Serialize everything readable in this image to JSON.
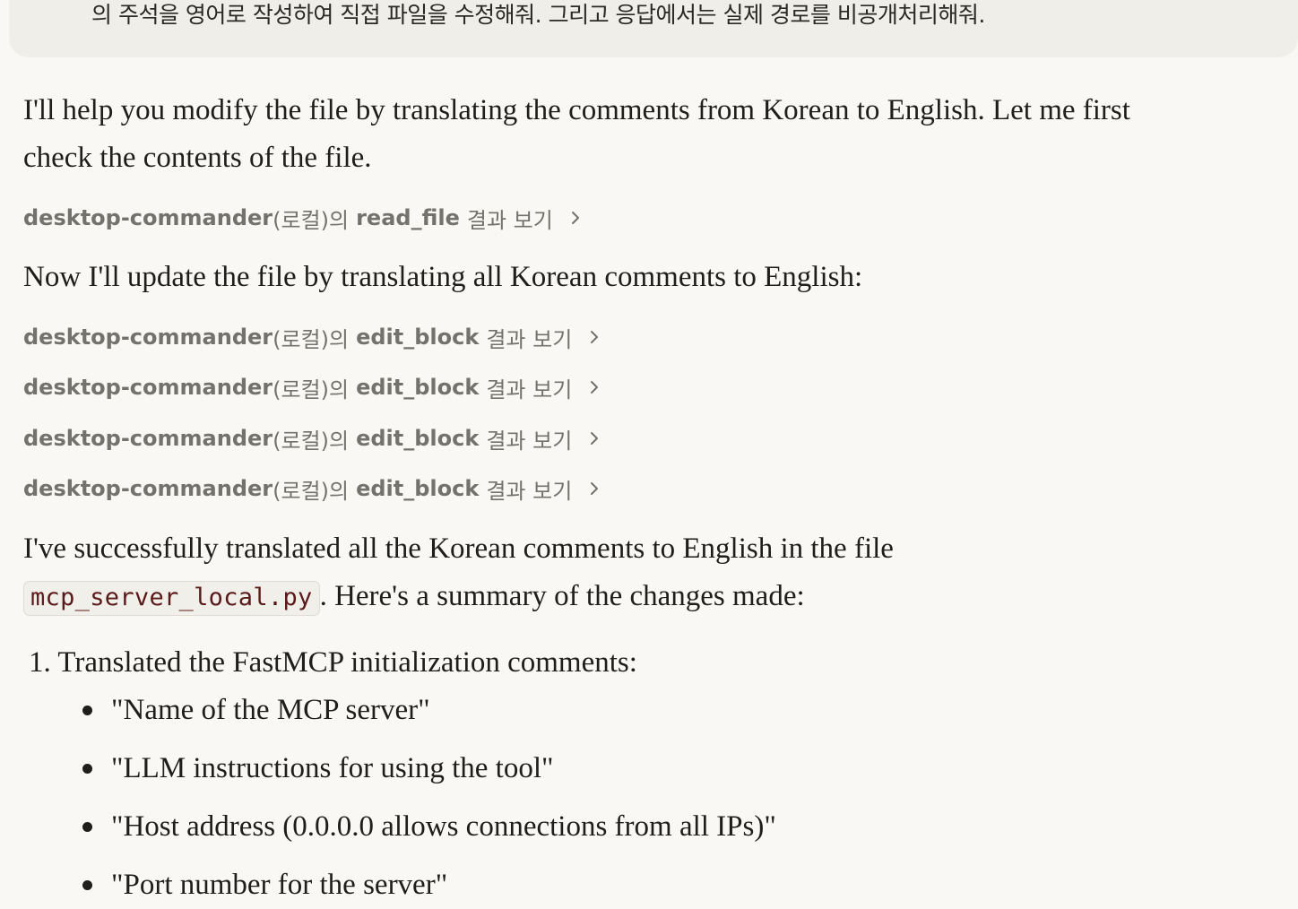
{
  "user_message": {
    "text": "의 주석을 영어로 작성하여 직접 파일을 수정해줘. 그리고 응답에서는 실제 경로를 비공개처리해줘."
  },
  "assistant": {
    "intro_line1": "I'll help you modify the file by translating the comments from Korean to English. Let me first",
    "intro_line2": "check the contents of the file.",
    "tool_calls": [
      {
        "server": "desktop-commander",
        "suffix": "(로컬)의",
        "tool": "read_file",
        "action": "결과 보기"
      },
      {
        "server": "desktop-commander",
        "suffix": "(로컬)의",
        "tool": "edit_block",
        "action": "결과 보기"
      },
      {
        "server": "desktop-commander",
        "suffix": "(로컬)의",
        "tool": "edit_block",
        "action": "결과 보기"
      },
      {
        "server": "desktop-commander",
        "suffix": "(로컬)의",
        "tool": "edit_block",
        "action": "결과 보기"
      },
      {
        "server": "desktop-commander",
        "suffix": "(로컬)의",
        "tool": "edit_block",
        "action": "결과 보기"
      }
    ],
    "update_line": "Now I'll update the file by translating all Korean comments to English:",
    "summary_line1": "I've successfully translated all the Korean comments to English in the file",
    "summary_code": "mcp_server_local.py",
    "summary_line2_rest": ". Here's a summary of the changes made:",
    "list_item_1": "1. Translated the FastMCP initialization comments:",
    "bullets": [
      "\"Name of the MCP server\"",
      "\"LLM instructions for using the tool\"",
      "\"Host address (0.0.0.0 allows connections from all IPs)\"",
      "\"Port number for the server\""
    ]
  },
  "icons": {
    "tool_chevron": "chevron-right-icon"
  }
}
